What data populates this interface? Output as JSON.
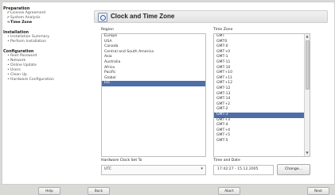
{
  "sidebar": {
    "sections": [
      {
        "title": "Preparation",
        "steps": [
          {
            "label": "License Agreement",
            "status": "done"
          },
          {
            "label": "System Analysis",
            "status": "done"
          },
          {
            "label": "Time Zone",
            "status": "current"
          }
        ]
      },
      {
        "title": "Installation",
        "steps": [
          {
            "label": "Installation Summary",
            "status": "pending"
          },
          {
            "label": "Perform Installation",
            "status": "pending"
          }
        ]
      },
      {
        "title": "Configuration",
        "steps": [
          {
            "label": "Root Password",
            "status": "pending"
          },
          {
            "label": "Network",
            "status": "pending"
          },
          {
            "label": "Online Update",
            "status": "pending"
          },
          {
            "label": "Users",
            "status": "pending"
          },
          {
            "label": "Clean Up",
            "status": "pending"
          },
          {
            "label": "Hardware Configuration",
            "status": "pending"
          }
        ]
      }
    ]
  },
  "main": {
    "title": "Clock and Time Zone",
    "region_label": "Region",
    "timezone_label": "Time Zone",
    "regions": [
      "Europe",
      "USA",
      "Canada",
      "Central and South America",
      "Asia",
      "Australia",
      "Africa",
      "Pacific",
      "Global",
      "Etc"
    ],
    "selected_region": "Etc",
    "timezones": [
      "GMT",
      "GMT0",
      "GMT-0",
      "GMT+0",
      "GMT-1",
      "GMT-11",
      "GMT-10",
      "GMT+10",
      "GMT+11",
      "GMT+12",
      "GMT-12",
      "GMT-13",
      "GMT-14",
      "GMT+2",
      "GMT-2",
      "GMT-3",
      "GMT+3",
      "GMT-4",
      "GMT+4",
      "GMT+5",
      "GMT-5"
    ],
    "selected_timezone": "GMT-3",
    "hardware_clock_label": "Hardware Clock Set To",
    "hardware_clock_value": "UTC",
    "time_date_label": "Time and Date",
    "time_date_value": "17:42:27 - 15.12.2005",
    "change_button": "Change..."
  },
  "footer": {
    "help": "Help",
    "back": "Back",
    "abort": "Abort",
    "next": "Next"
  },
  "colors": {
    "selection": "#4f6ea8",
    "done": "#2d7a2d",
    "current": "#2a4e86"
  }
}
